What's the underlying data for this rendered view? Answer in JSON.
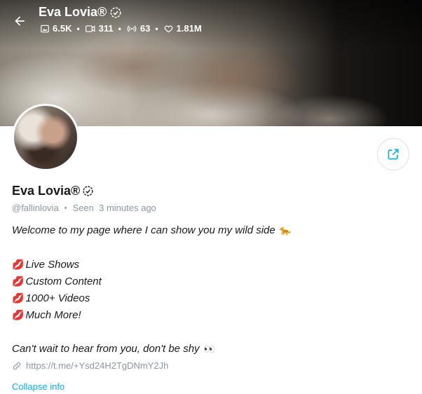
{
  "header": {
    "title": "Eva Lovia®",
    "stats": [
      {
        "icon": "photo-icon",
        "value": "6.5K"
      },
      {
        "icon": "video-icon",
        "value": "311"
      },
      {
        "icon": "stream-icon",
        "value": "63"
      },
      {
        "icon": "heart-icon",
        "value": "1.81M"
      }
    ]
  },
  "profile": {
    "name": "Eva Lovia®",
    "handle": "@fallinlovia",
    "seen": "Seen  3 minutes ago",
    "bio": {
      "intro": "Welcome to my page where I can show you my wild side",
      "intro_emoji": "🐆",
      "items": [
        "Live Shows",
        "Custom Content",
        "1000+ Videos",
        "Much More!"
      ],
      "item_emoji": "💋",
      "outro": "Can't wait to hear from you, don't be shy",
      "outro_emoji": "👀"
    },
    "link": "https://t.me/+Ysd24H2TgDNmY2Jh",
    "collapse_label": "Collapse info"
  },
  "colors": {
    "accent": "#00aff0",
    "muted": "#8a96a3",
    "text": "#1a1a1a"
  }
}
